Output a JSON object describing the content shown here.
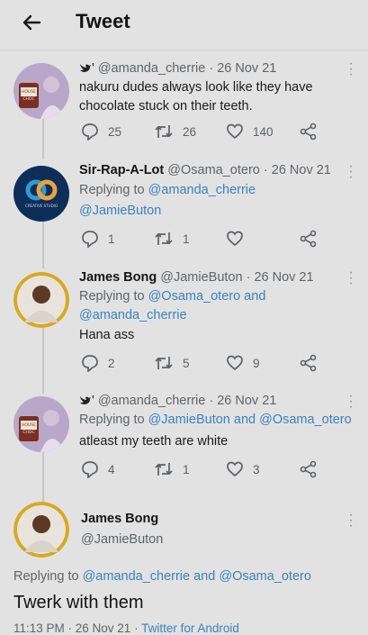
{
  "header": {
    "title": "Tweet"
  },
  "tweets": [
    {
      "badge": "'",
      "handle": "@amanda_cherrie",
      "date": "26 Nov 21",
      "text_lines": [
        "nakuru dudes always look like they have",
        "chocolate stuck on their teeth."
      ],
      "replies": "25",
      "retweets": "26",
      "likes": "140"
    },
    {
      "name": "Sir-Rap-A-Lot",
      "handle": "@Osama_otero",
      "date": "26 Nov 21",
      "replying_prefix": "Replying to ",
      "replying_to": [
        "@amanda_cherrie",
        "@JamieButon"
      ],
      "replies": "1",
      "retweets": "1",
      "likes": ""
    },
    {
      "name": "James Bong",
      "handle": "@JamieButon",
      "date": "26 Nov 21",
      "replying_prefix": "Replying to ",
      "replying_to": [
        "@Osama_otero",
        "@amanda_cherrie"
      ],
      "replying_and": " and",
      "text": "Hana ass",
      "replies": "2",
      "retweets": "5",
      "likes": "9"
    },
    {
      "badge": "'",
      "handle": "@amanda_cherrie",
      "date": "26 Nov 21",
      "replying_prefix": "Replying to ",
      "replying_to": [
        "@JamieButon",
        "@Osama_otero"
      ],
      "replying_and": " and ",
      "text": "atleast my teeth are white",
      "replies": "4",
      "retweets": "1",
      "likes": "3"
    }
  ],
  "main": {
    "name": "James Bong",
    "handle": "@JamieButon",
    "replying_prefix": "Replying to ",
    "replying_to": [
      "@amanda_cherrie",
      "@Osama_otero"
    ],
    "replying_and": " and ",
    "text": "Twerk with them",
    "meta_time": "11:13 PM · 26 Nov 21 · ",
    "meta_source": "Twitter for Android"
  },
  "avatars": {
    "amanda_label_1": "HOUSE",
    "amanda_label_2": "CHOC",
    "osama_text": "CREATIVE STUDIO"
  },
  "colors": {
    "link": "#3a82bf",
    "background": "#e2e2e2"
  }
}
